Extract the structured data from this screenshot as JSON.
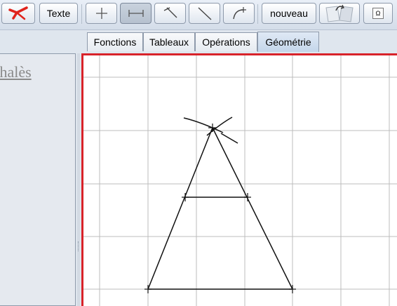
{
  "toolbar": {
    "text_button": "Texte",
    "new_button": "nouveau",
    "omega_button": "Ω"
  },
  "tabs": [
    "Fonctions",
    "Tableaux",
    "Opérations",
    "Géométrie"
  ],
  "active_tab": "Géométrie",
  "left_panel": {
    "title": "Thalès"
  },
  "colors": {
    "canvas_border": "#d8232a",
    "grid": "#b9b9b9",
    "accent_logo": "#e0231c"
  }
}
